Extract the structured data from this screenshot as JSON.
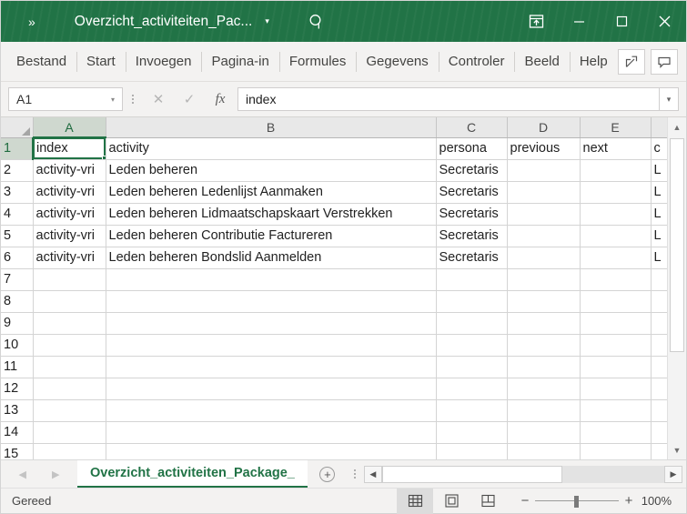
{
  "window": {
    "title": "Overzicht_activiteiten_Pac...",
    "qat_overflow": "»",
    "title_caret": "▾",
    "search_icon": "search-icon",
    "buttons": {
      "ribbon_display": "Weergaveopties voor lint",
      "minimize": "—",
      "maximize": "□",
      "close": "✕"
    }
  },
  "ribbon": {
    "tabs": [
      {
        "label": "Bestand"
      },
      {
        "label": "Start"
      },
      {
        "label": "Invoegen"
      },
      {
        "label": "Pagina-in"
      },
      {
        "label": "Formules"
      },
      {
        "label": "Gegevens"
      },
      {
        "label": "Controler"
      },
      {
        "label": "Beeld"
      },
      {
        "label": "Help"
      }
    ],
    "share_label": "Delen",
    "comments_label": "Opmerkingen"
  },
  "formula_bar": {
    "name_box_value": "A1",
    "name_box_caret": "▾",
    "cancel_icon": "✕",
    "confirm_icon": "✓",
    "fx_label": "fx",
    "formula_value": "index",
    "expand_caret": "▾"
  },
  "grid": {
    "columns": [
      {
        "label": "A",
        "selected": true
      },
      {
        "label": "B",
        "selected": false
      },
      {
        "label": "C",
        "selected": false
      },
      {
        "label": "D",
        "selected": false
      },
      {
        "label": "E",
        "selected": false
      },
      {
        "label": "",
        "selected": false
      }
    ],
    "selected_cell": "A1",
    "rows": [
      {
        "number": "1",
        "selected": true,
        "cells": [
          "index",
          "activity",
          "persona",
          "previous",
          "next",
          "c"
        ]
      },
      {
        "number": "2",
        "selected": false,
        "cells": [
          "activity-vri",
          "Leden beheren",
          "Secretaris",
          "",
          "",
          "L"
        ]
      },
      {
        "number": "3",
        "selected": false,
        "cells": [
          "activity-vri",
          "Leden beheren Ledenlijst Aanmaken",
          "Secretaris",
          "",
          "",
          "L"
        ]
      },
      {
        "number": "4",
        "selected": false,
        "cells": [
          "activity-vri",
          "Leden beheren Lidmaatschapskaart Verstrekken",
          "Secretaris",
          "",
          "",
          "L"
        ]
      },
      {
        "number": "5",
        "selected": false,
        "cells": [
          "activity-vri",
          "Leden beheren Contributie Factureren",
          "Secretaris",
          "",
          "",
          "L"
        ]
      },
      {
        "number": "6",
        "selected": false,
        "cells": [
          "activity-vri",
          "Leden beheren Bondslid Aanmelden",
          "Secretaris",
          "",
          "",
          "L"
        ]
      },
      {
        "number": "7",
        "selected": false,
        "cells": [
          "",
          "",
          "",
          "",
          "",
          ""
        ]
      },
      {
        "number": "8",
        "selected": false,
        "cells": [
          "",
          "",
          "",
          "",
          "",
          ""
        ]
      },
      {
        "number": "9",
        "selected": false,
        "cells": [
          "",
          "",
          "",
          "",
          "",
          ""
        ]
      },
      {
        "number": "10",
        "selected": false,
        "cells": [
          "",
          "",
          "",
          "",
          "",
          ""
        ]
      },
      {
        "number": "11",
        "selected": false,
        "cells": [
          "",
          "",
          "",
          "",
          "",
          ""
        ]
      },
      {
        "number": "12",
        "selected": false,
        "cells": [
          "",
          "",
          "",
          "",
          "",
          ""
        ]
      },
      {
        "number": "13",
        "selected": false,
        "cells": [
          "",
          "",
          "",
          "",
          "",
          ""
        ]
      },
      {
        "number": "14",
        "selected": false,
        "cells": [
          "",
          "",
          "",
          "",
          "",
          ""
        ]
      },
      {
        "number": "15",
        "selected": false,
        "cells": [
          "",
          "",
          "",
          "",
          "",
          ""
        ]
      }
    ]
  },
  "scrollbars": {
    "v_up": "▲",
    "v_down": "▼",
    "h_left": "◀",
    "h_right": "▶"
  },
  "sheet_tabs": {
    "prev_icon": "◀",
    "next_icon": "▶",
    "active_tab": "Overzicht_activiteiten_Package_",
    "add_sheet": "+"
  },
  "status_bar": {
    "status": "Gereed",
    "views": [
      {
        "name": "normal-view",
        "active": true
      },
      {
        "name": "page-layout-view",
        "active": false
      },
      {
        "name": "page-break-view",
        "active": false
      }
    ],
    "zoom_out": "−",
    "zoom_in": "+",
    "zoom_level": "100%"
  },
  "colors": {
    "accent": "#217346",
    "titlebar": "#217346",
    "chrome": "#f3f2f1"
  }
}
